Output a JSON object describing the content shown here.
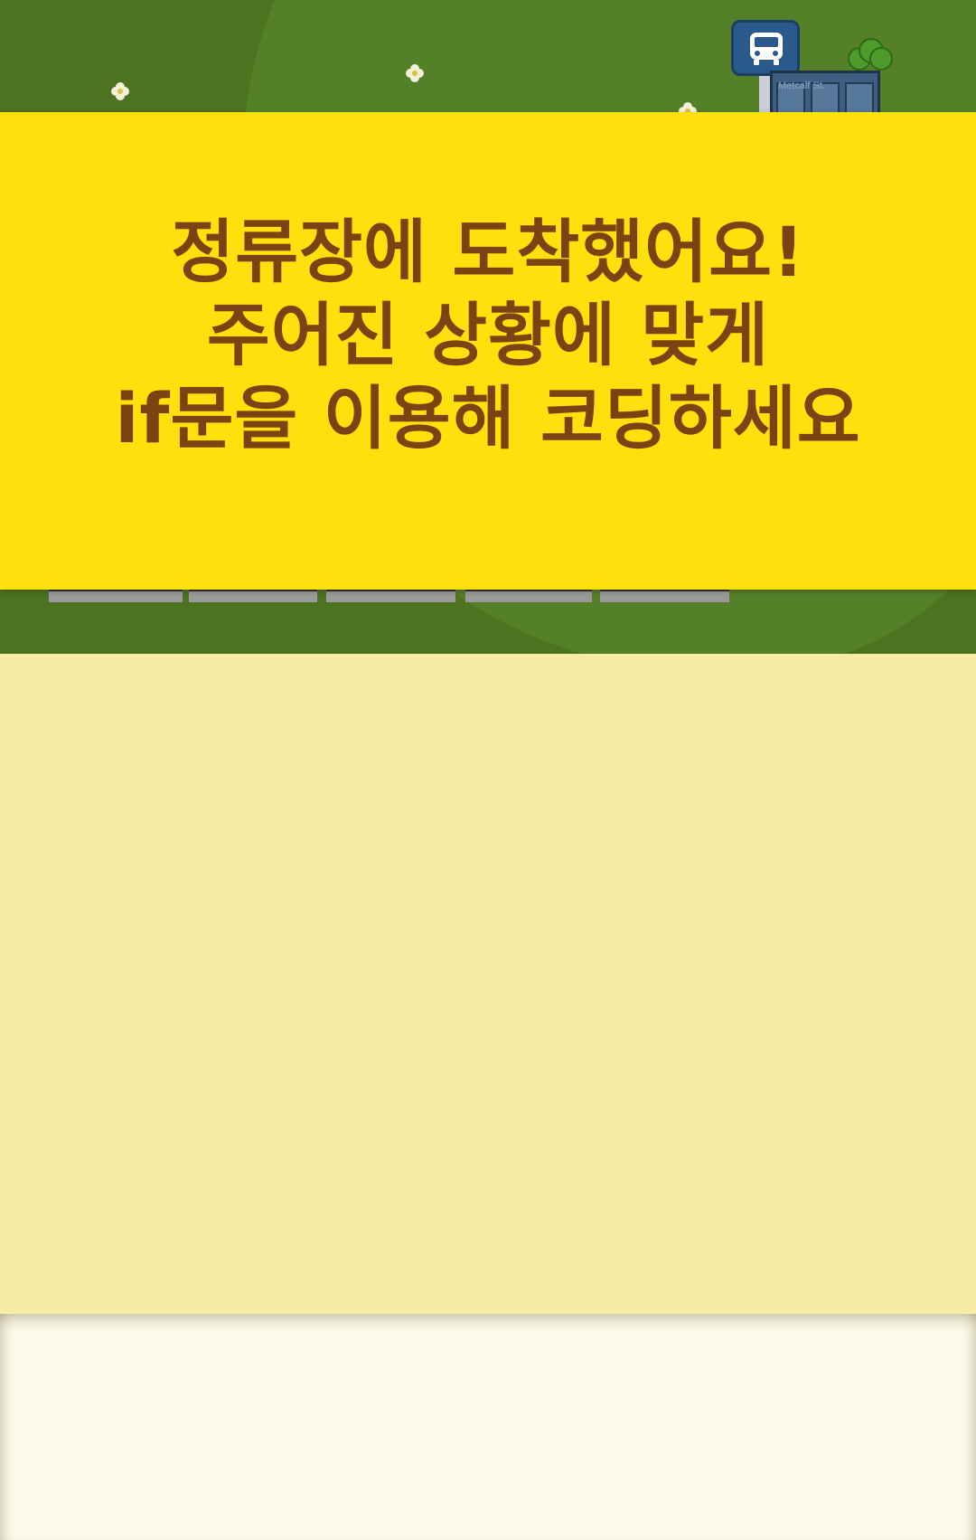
{
  "banner": {
    "line1": "정류장에 도착했어요!",
    "line2": "주어진 상황에 맞게",
    "line3": "if문을 이용해 코딩하세요"
  },
  "scene": {
    "bus_stop_icon": "bus-icon",
    "shelter_label": "Metcalf St."
  },
  "colors": {
    "banner_bg": "#fde00c",
    "banner_text": "#7a4412",
    "grass": "#4d7320",
    "code_area": "#f6eca5",
    "bottom_panel": "#fdfbeb"
  }
}
